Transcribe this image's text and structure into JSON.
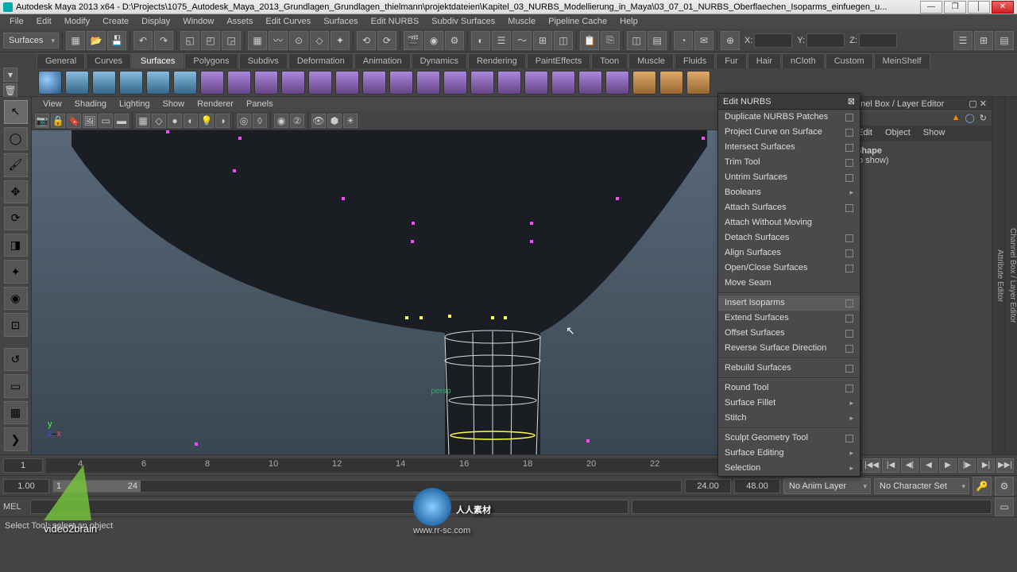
{
  "title": "Autodesk Maya 2013 x64  -  D:\\Projects\\1075_Autodesk_Maya_2013_Grundlagen_Grundlagen_thielmann\\projektdateien\\Kapitel_03_NURBS_Modellierung_in_Maya\\03_07_01_NURBS_Oberflaechen_Isoparms_einfuegen_u...",
  "winbtns": {
    "min": "—",
    "max": "❐",
    "sep": "│",
    "close": "✕"
  },
  "menubar": [
    "File",
    "Edit",
    "Modify",
    "Create",
    "Display",
    "Window",
    "Assets",
    "Edit Curves",
    "Surfaces",
    "Edit NURBS",
    "Subdiv Surfaces",
    "Muscle",
    "Pipeline Cache",
    "Help"
  ],
  "module_dropdown": "Surfaces",
  "coord_labels": {
    "x": "X:",
    "y": "Y:",
    "z": "Z:"
  },
  "shelf_tabs": [
    "General",
    "Curves",
    "Surfaces",
    "Polygons",
    "Subdivs",
    "Deformation",
    "Animation",
    "Dynamics",
    "Rendering",
    "PaintEffects",
    "Toon",
    "Muscle",
    "Fluids",
    "Fur",
    "Hair",
    "nCloth",
    "Custom",
    "MeinShelf"
  ],
  "shelf_active": 2,
  "panel_menu": [
    "View",
    "Shading",
    "Lighting",
    "Show",
    "Renderer",
    "Panels"
  ],
  "persp_label": "persp",
  "side_panel": {
    "header": "nnel Box / Layer Editor",
    "tabs": [
      "Edit",
      "Object",
      "Show"
    ],
    "line1": "Shape",
    "line2": "to show)"
  },
  "vert_tabs": [
    "Attribute Editor",
    "Channel Box / Layer Editor"
  ],
  "float_menu": {
    "title": "Edit NURBS",
    "close": "⊠",
    "items": [
      {
        "label": "Duplicate NURBS Patches",
        "opt": true
      },
      {
        "label": "Project Curve on Surface",
        "opt": true
      },
      {
        "label": "Intersect Surfaces",
        "opt": true
      },
      {
        "label": "Trim Tool",
        "opt": true
      },
      {
        "label": "Untrim Surfaces",
        "opt": true
      },
      {
        "label": "Booleans",
        "sub": true
      },
      {
        "label": "Attach Surfaces",
        "opt": true
      },
      {
        "label": "Attach Without Moving"
      },
      {
        "label": "Detach Surfaces",
        "opt": true
      },
      {
        "label": "Align Surfaces",
        "opt": true
      },
      {
        "label": "Open/Close Surfaces",
        "opt": true
      },
      {
        "label": "Move Seam"
      },
      {
        "sep": true
      },
      {
        "label": "Insert Isoparms",
        "opt": true
      },
      {
        "label": "Extend Surfaces",
        "opt": true
      },
      {
        "label": "Offset Surfaces",
        "opt": true
      },
      {
        "label": "Reverse Surface Direction",
        "opt": true
      },
      {
        "sep": true
      },
      {
        "label": "Rebuild Surfaces",
        "opt": true
      },
      {
        "sep": true
      },
      {
        "label": "Round Tool",
        "opt": true
      },
      {
        "label": "Surface Fillet",
        "sub": true
      },
      {
        "label": "Stitch",
        "sub": true
      },
      {
        "sep": true
      },
      {
        "label": "Sculpt Geometry Tool",
        "opt": true
      },
      {
        "label": "Surface Editing",
        "sub": true
      },
      {
        "label": "Selection",
        "sub": true
      }
    ]
  },
  "timeline": {
    "start_vis": "1",
    "ticks": [
      "4",
      "6",
      "8",
      "10",
      "12",
      "14",
      "16",
      "18",
      "20",
      "22"
    ],
    "cur_frame": "1.00"
  },
  "range": {
    "start": "1.00",
    "thumb_start": "1",
    "thumb_end": "24",
    "end": "24.00",
    "total": "48.00",
    "anim_layer": "No Anim Layer",
    "char_set": "No Character Set"
  },
  "playback": {
    "go_start": "|◀◀",
    "step_back": "|◀",
    "key_back": "◀|",
    "play_back": "◀",
    "play_fwd": "▶",
    "key_fwd": "|▶",
    "step_fwd": "▶|",
    "go_end": "▶▶|"
  },
  "cmd": {
    "lang": "MEL"
  },
  "status": "Select Tool: select an object",
  "watermark": {
    "brand": "video2brain",
    "cn": "人人素材",
    "url": "www.rr-sc.com"
  }
}
